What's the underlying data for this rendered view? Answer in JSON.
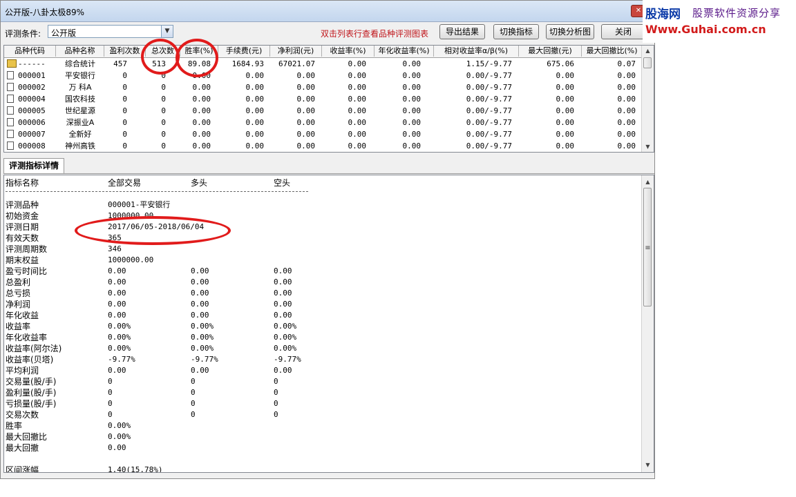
{
  "window": {
    "title": "公开版-八卦太极89%",
    "close_glyph": "✕"
  },
  "watermark": {
    "logo": "股海网",
    "slogan": "股票软件资源分享",
    "url": "Www.Guhai.com.cn"
  },
  "toolbar": {
    "condition_label": "评测条件:",
    "condition_value": "公开版",
    "hint": "双击列表行查看品种评测图表",
    "buttons": {
      "export": "导出结果",
      "switch_indicator": "切换指标",
      "switch_chart": "切换分析图",
      "close": "关闭"
    }
  },
  "grid": {
    "columns": [
      "品种代码",
      "品种名称",
      "盈利次数",
      "总次数",
      "胜率(%)",
      "手续费(元)",
      "净利润(元)",
      "收益率(%)",
      "年化收益率(%)",
      "相对收益率α/β(%)",
      "最大回撤(元)",
      "最大回撤比(%)"
    ],
    "rows": [
      [
        "------",
        "综合统计",
        "457",
        "513",
        "89.08",
        "1684.93",
        "67021.07",
        "0.00",
        "0.00",
        "1.15/-9.77",
        "675.06",
        "0.07"
      ],
      [
        "000001",
        "平安银行",
        "0",
        "0",
        "0.00",
        "0.00",
        "0.00",
        "0.00",
        "0.00",
        "0.00/-9.77",
        "0.00",
        "0.00"
      ],
      [
        "000002",
        "万 科A",
        "0",
        "0",
        "0.00",
        "0.00",
        "0.00",
        "0.00",
        "0.00",
        "0.00/-9.77",
        "0.00",
        "0.00"
      ],
      [
        "000004",
        "国农科技",
        "0",
        "0",
        "0.00",
        "0.00",
        "0.00",
        "0.00",
        "0.00",
        "0.00/-9.77",
        "0.00",
        "0.00"
      ],
      [
        "000005",
        "世纪星源",
        "0",
        "0",
        "0.00",
        "0.00",
        "0.00",
        "0.00",
        "0.00",
        "0.00/-9.77",
        "0.00",
        "0.00"
      ],
      [
        "000006",
        "深振业A",
        "0",
        "0",
        "0.00",
        "0.00",
        "0.00",
        "0.00",
        "0.00",
        "0.00/-9.77",
        "0.00",
        "0.00"
      ],
      [
        "000007",
        "全新好",
        "0",
        "0",
        "0.00",
        "0.00",
        "0.00",
        "0.00",
        "0.00",
        "0.00/-9.77",
        "0.00",
        "0.00"
      ],
      [
        "000008",
        "神州高铁",
        "0",
        "0",
        "0.00",
        "0.00",
        "0.00",
        "0.00",
        "0.00",
        "0.00/-9.77",
        "0.00",
        "0.00"
      ]
    ]
  },
  "detail_tab": "评测指标详情",
  "detail": {
    "headers": [
      "指标名称",
      "全部交易",
      "多头",
      "空头"
    ],
    "rows": [
      [
        "评测品种",
        "000001-平安银行",
        "",
        ""
      ],
      [
        "初始资金",
        "1000000.00",
        "",
        ""
      ],
      [
        "评测日期",
        "2017/06/05-2018/06/04",
        "",
        ""
      ],
      [
        "有效天数",
        "365",
        "",
        ""
      ],
      [
        "评测周期数",
        "346",
        "",
        ""
      ],
      [
        "期末权益",
        "1000000.00",
        "",
        ""
      ],
      [
        "盈亏时间比",
        "0.00",
        "0.00",
        "0.00"
      ],
      [
        "总盈利",
        "0.00",
        "0.00",
        "0.00"
      ],
      [
        "总亏损",
        "0.00",
        "0.00",
        "0.00"
      ],
      [
        "净利润",
        "0.00",
        "0.00",
        "0.00"
      ],
      [
        "年化收益",
        "0.00",
        "0.00",
        "0.00"
      ],
      [
        "收益率",
        "0.00%",
        "0.00%",
        "0.00%"
      ],
      [
        "年化收益率",
        "0.00%",
        "0.00%",
        "0.00%"
      ],
      [
        "收益率(阿尔法)",
        "0.00%",
        "0.00%",
        "0.00%"
      ],
      [
        "收益率(贝塔)",
        "-9.77%",
        "-9.77%",
        "-9.77%"
      ],
      [
        "平均利润",
        "0.00",
        "0.00",
        "0.00"
      ],
      [
        "交易量(股/手)",
        "0",
        "0",
        "0"
      ],
      [
        "盈利量(股/手)",
        "0",
        "0",
        "0"
      ],
      [
        "亏损量(股/手)",
        "0",
        "0",
        "0"
      ],
      [
        "交易次数",
        "0",
        "0",
        "0"
      ],
      [
        "胜率",
        "0.00%",
        "",
        ""
      ],
      [
        "最大回撤比",
        "0.00%",
        "",
        ""
      ],
      [
        "最大回撤",
        "0.00",
        "",
        ""
      ],
      [
        "",
        "",
        "",
        ""
      ],
      [
        "区间涨幅",
        "1.40(15.78%)",
        "",
        ""
      ]
    ]
  },
  "colors": {
    "annotation": "#e11b1b",
    "hint": "#c0151a"
  },
  "icons": {
    "summary_row": "folder-icon",
    "stock_row": "document-icon",
    "dropdown": "chevron-down-icon"
  }
}
